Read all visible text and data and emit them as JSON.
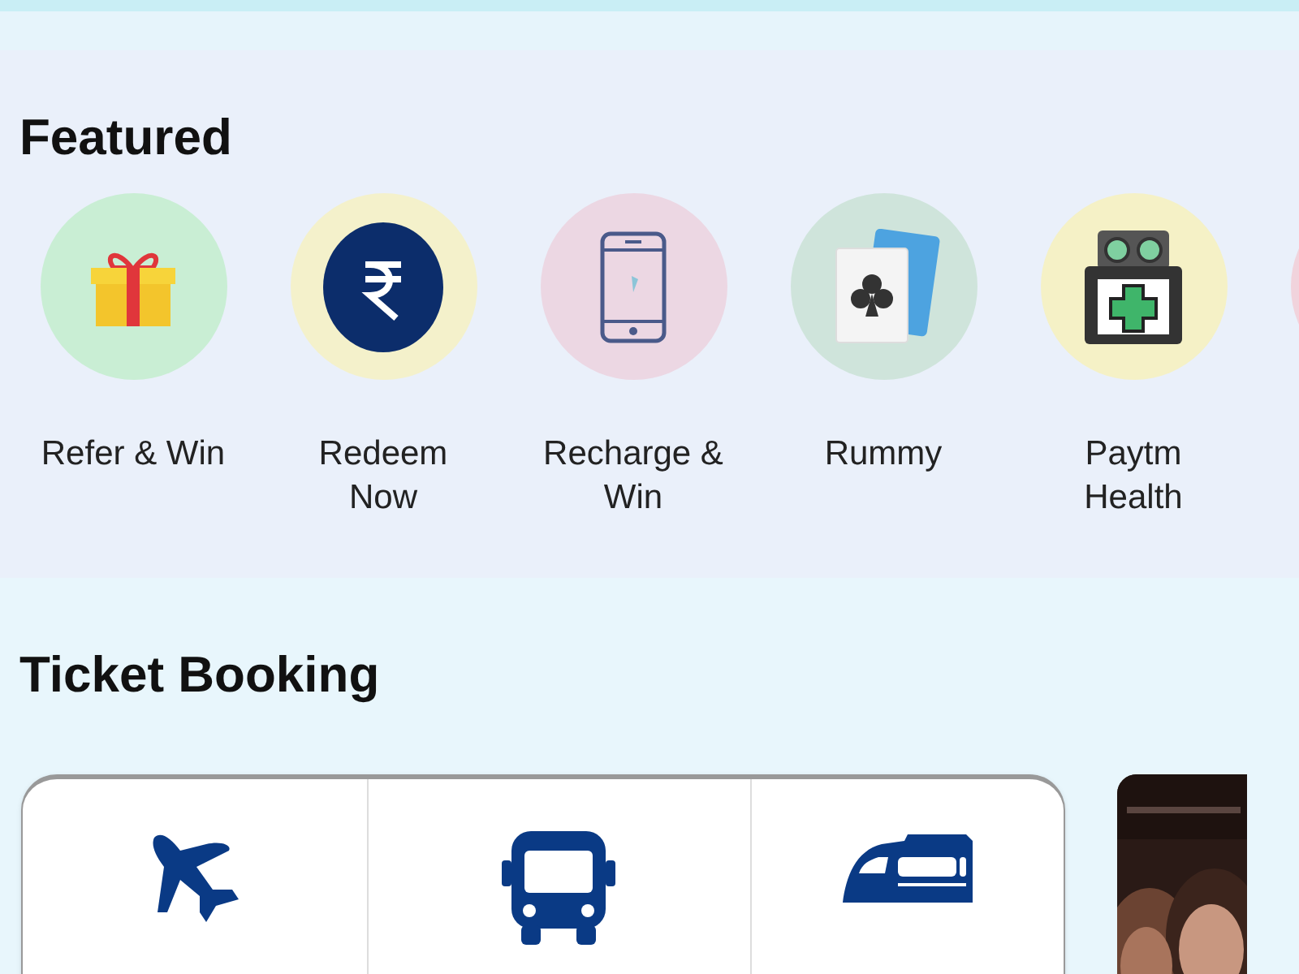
{
  "featured": {
    "title": "Featured",
    "items": [
      {
        "kind": "gift",
        "label": "Refer & Win",
        "color": "#c9eed4"
      },
      {
        "kind": "rupee",
        "label": "Redeem Now",
        "color": "#f4f1cb"
      },
      {
        "kind": "phone",
        "label": "Recharge & Win",
        "color": "#ecd7e3"
      },
      {
        "kind": "cards",
        "label": "Rummy",
        "color": "#cfe4db"
      },
      {
        "kind": "health",
        "label": "Paytm Health",
        "color": "#f5f1c6"
      },
      {
        "kind": "blank",
        "color": "#f1d3dc"
      }
    ]
  },
  "ticket_booking": {
    "title": "Ticket Booking",
    "options": [
      {
        "kind": "plane"
      },
      {
        "kind": "bus"
      },
      {
        "kind": "train"
      }
    ]
  }
}
